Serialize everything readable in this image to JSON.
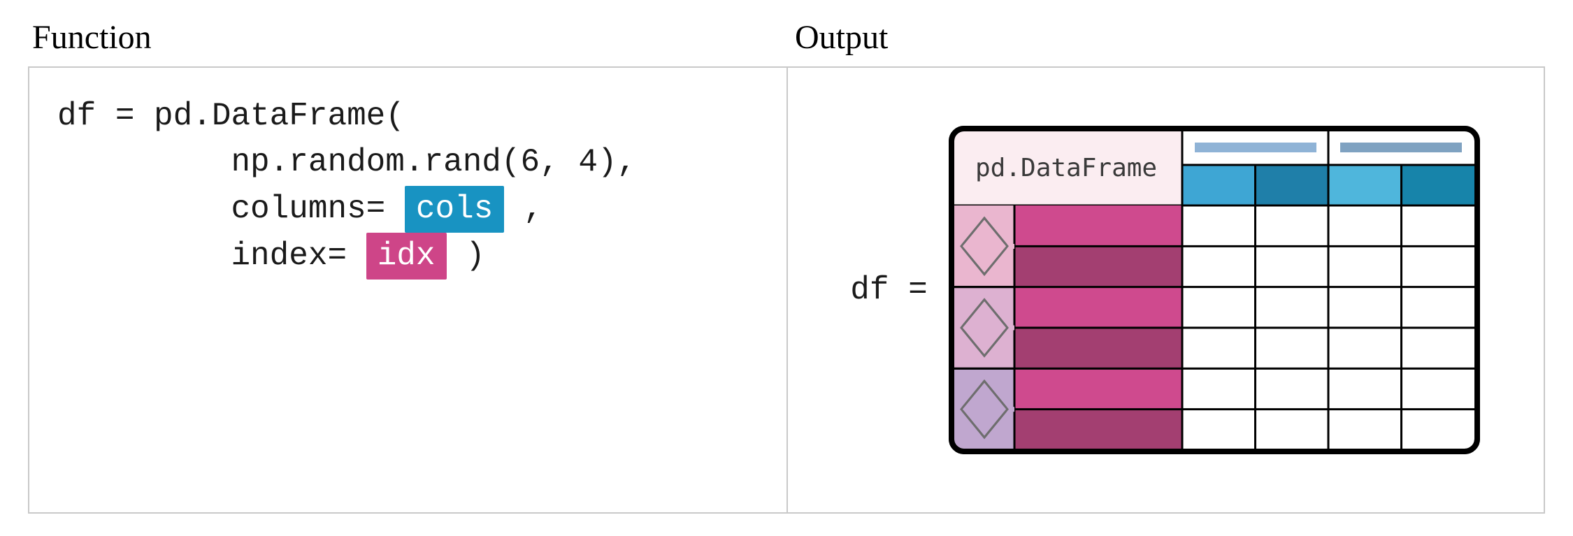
{
  "headers": {
    "function": "Function",
    "output": "Output"
  },
  "code": {
    "line1_a": "df = pd.DataFrame(",
    "line2_a": "         np.random.rand(6, 4),",
    "line3_a": "         columns=",
    "line3_hl": "cols",
    "line3_b": ",",
    "line4_a": "         index=",
    "line4_hl": "idx",
    "line4_b": ")"
  },
  "output": {
    "eq_label": "df =",
    "frame_label": "pd.DataFrame"
  },
  "chart_data": {
    "type": "table",
    "title": "pd.DataFrame schematic",
    "description": "Conceptual DataFrame: 6 rows × 4 columns, MultiIndex on both axes (2 column levels, 2 row-index levels).",
    "n_rows": 6,
    "n_cols": 4,
    "column_levels": 2,
    "index_levels": 2,
    "column_outer_spans": [
      2,
      2
    ],
    "index_outer_spans": [
      2,
      2,
      2
    ],
    "index_outer_colors": [
      "#e6a6c7",
      "#d9a3ca",
      "#b99bc9"
    ],
    "index_inner_row_colors": [
      "#cf4a8e",
      "#a33f71",
      "#cf4a8e",
      "#a33f71",
      "#cf4a8e",
      "#a33f71"
    ],
    "column_outer_bar_colors": [
      "#9cbadb",
      "#8ca9c6"
    ],
    "column_inner_colors": [
      "#3ea6d4",
      "#1f7fa9",
      "#4fb6dc",
      "#1784aa"
    ],
    "corner_fill": "#fbedf1",
    "corner_label": "pd.DataFrame",
    "corner_label_font": "monospace"
  }
}
